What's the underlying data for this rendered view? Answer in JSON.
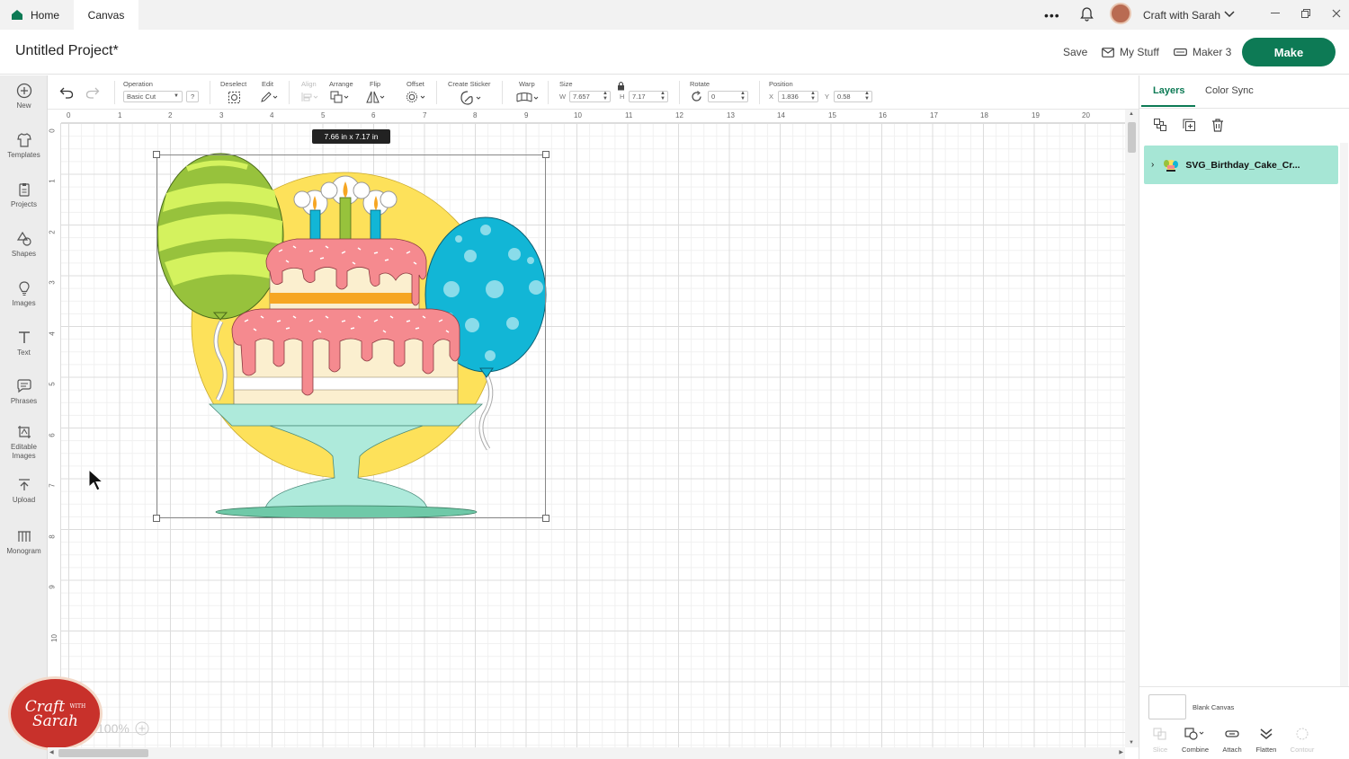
{
  "titlebar": {
    "tabs": [
      {
        "label": "Home"
      },
      {
        "label": "Canvas"
      }
    ],
    "more_label": "•••",
    "user_name": "Craft with Sarah"
  },
  "header": {
    "project_title": "Untitled Project*",
    "save_label": "Save",
    "my_stuff_label": "My Stuff",
    "machine_label": "Maker 3",
    "make_label": "Make"
  },
  "sidebar": {
    "items": [
      {
        "label": "New",
        "icon": "plus-circle-icon"
      },
      {
        "label": "Templates",
        "icon": "shirt-icon"
      },
      {
        "label": "Projects",
        "icon": "clipboard-icon"
      },
      {
        "label": "Shapes",
        "icon": "shapes-icon"
      },
      {
        "label": "Images",
        "icon": "lightbulb-icon"
      },
      {
        "label": "Text",
        "icon": "text-icon"
      },
      {
        "label": "Phrases",
        "icon": "speech-bubble-icon"
      },
      {
        "label": "Editable Images",
        "icon": "editable-image-icon"
      },
      {
        "label": "Upload",
        "icon": "upload-icon"
      },
      {
        "label": "Monogram",
        "icon": "monogram-icon"
      }
    ]
  },
  "toolbar": {
    "operation_label": "Operation",
    "operation_value": "Basic Cut",
    "help_label": "?",
    "deselect_label": "Deselect",
    "edit_label": "Edit",
    "align_label": "Align",
    "arrange_label": "Arrange",
    "flip_label": "Flip",
    "offset_label": "Offset",
    "sticker_label": "Create Sticker",
    "warp_label": "Warp",
    "size_label": "Size",
    "w_label": "W",
    "w_value": "7.657",
    "h_label": "H",
    "h_value": "7.17",
    "rotate_label": "Rotate",
    "rotate_value": "0",
    "position_label": "Position",
    "x_label": "X",
    "x_value": "1.836",
    "y_label": "Y",
    "y_value": "0.58"
  },
  "ruler": {
    "top": [
      "0",
      "1",
      "2",
      "3",
      "4",
      "5",
      "6",
      "7",
      "8",
      "9",
      "10",
      "11",
      "12",
      "13",
      "14",
      "15",
      "16",
      "17",
      "18",
      "19",
      "20"
    ],
    "left": [
      "0",
      "1",
      "2",
      "3",
      "4",
      "5",
      "6",
      "7",
      "8",
      "9",
      "10"
    ]
  },
  "canvas": {
    "size_tooltip": "7.66  in x 7.17  in",
    "zoom_value": "100%",
    "logo_line1": "Craft",
    "logo_with": "WITH",
    "logo_line2": "Sarah",
    "colors": {
      "green_balloon": "#97c23c",
      "green_stripe": "#d4f25e",
      "blue_balloon": "#12b6d6",
      "sun": "#fde15a",
      "frosting": "#f58a8f",
      "cake": "#fbefcf",
      "stand": "#aeeadb",
      "accent": "#0d7a55"
    }
  },
  "right_panel": {
    "tabs": [
      {
        "label": "Layers"
      },
      {
        "label": "Color Sync"
      }
    ],
    "layer_name": "SVG_Birthday_Cake_Cr...",
    "blank_canvas_label": "Blank Canvas",
    "tools": [
      {
        "label": "Slice",
        "icon": "slice-icon"
      },
      {
        "label": "Combine",
        "icon": "combine-icon"
      },
      {
        "label": "Attach",
        "icon": "attach-icon"
      },
      {
        "label": "Flatten",
        "icon": "flatten-icon"
      },
      {
        "label": "Contour",
        "icon": "contour-icon"
      }
    ]
  }
}
